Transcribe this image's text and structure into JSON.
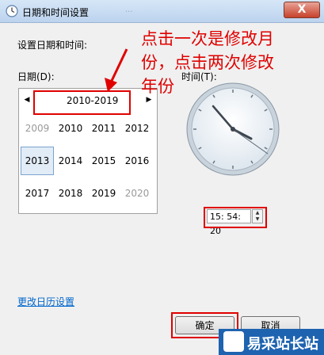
{
  "window": {
    "title": "日期和时间设置",
    "title_blurred": "...",
    "close_label": "X"
  },
  "labels": {
    "heading": "设置日期和时间:",
    "date": "日期(D):",
    "time": "时间(T):"
  },
  "calendar": {
    "prev": "◀",
    "next": "▶",
    "header": "2010-2019",
    "years": [
      {
        "label": "2009",
        "dim": true
      },
      {
        "label": "2010"
      },
      {
        "label": "2011"
      },
      {
        "label": "2012"
      },
      {
        "label": "2013",
        "selected": true
      },
      {
        "label": "2014"
      },
      {
        "label": "2015"
      },
      {
        "label": "2016"
      },
      {
        "label": "2017"
      },
      {
        "label": "2018"
      },
      {
        "label": "2019"
      },
      {
        "label": "2020",
        "dim": true
      }
    ]
  },
  "time": {
    "value": "15: 54: 20",
    "up": "▲",
    "down": "▼"
  },
  "link": "更改日历设置",
  "buttons": {
    "ok": "确定",
    "cancel": "取消"
  },
  "annotation": {
    "line1": "点击一次是修改月",
    "line2": "份，点击两次修改",
    "line3": "年份"
  },
  "watermark": {
    "text": "易采站长站"
  },
  "colors": {
    "annotation_red": "#e00000",
    "link": "#0066cc",
    "watermark_bg": "#1e63b0"
  }
}
